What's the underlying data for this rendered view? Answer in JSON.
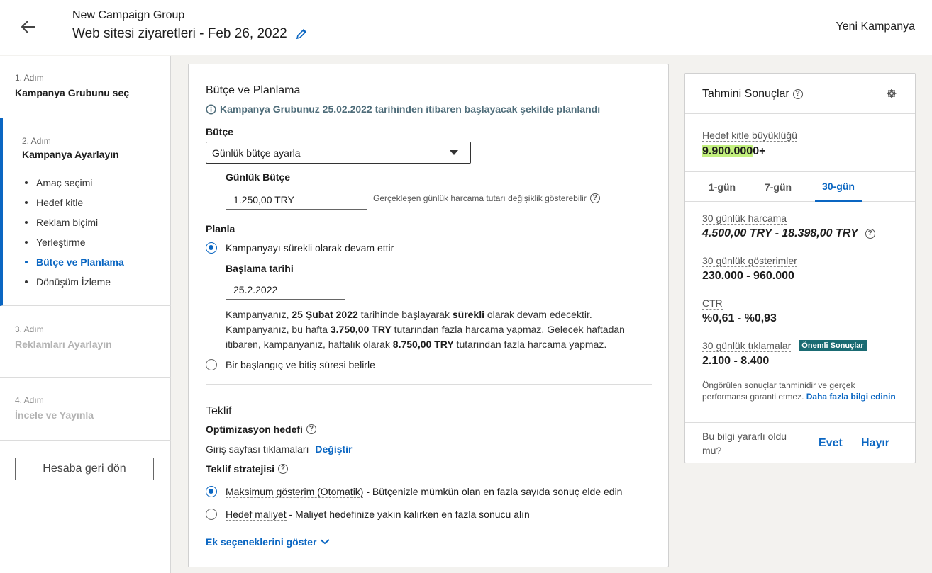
{
  "header": {
    "group_name": "New Campaign Group",
    "campaign_title": "Web sitesi ziyaretleri - Feb 26, 2022",
    "new_campaign": "Yeni Kampanya"
  },
  "sidebar": {
    "steps": [
      {
        "num": "1. Adım",
        "title": "Kampanya Grubunu seç"
      },
      {
        "num": "2. Adım",
        "title": "Kampanya Ayarlayın"
      },
      {
        "num": "3. Adım",
        "title": "Reklamları Ayarlayın"
      },
      {
        "num": "4. Adım",
        "title": "İncele ve Yayınla"
      }
    ],
    "substeps": [
      "Amaç seçimi",
      "Hedef kitle",
      "Reklam biçimi",
      "Yerleştirme",
      "Bütçe ve Planlama",
      "Dönüşüm İzleme"
    ],
    "back_button": "Hesaba geri dön"
  },
  "budget": {
    "section_title": "Bütçe ve Planlama",
    "info": "Kampanya Grubunuz 25.02.2022 tarihinden itibaren başlayacak şekilde planlandı",
    "budget_label": "Bütçe",
    "budget_select": "Günlük bütçe ayarla",
    "daily_label": "Günlük Bütçe",
    "daily_value": "1.250,00 TRY",
    "daily_hint": "Gerçekleşen günlük harcama tutarı değişiklik gösterebilir",
    "plan_label": "Planla",
    "radio_continuous": "Kampanyayı sürekli olarak devam ettir",
    "start_label": "Başlama tarihi",
    "start_value": "25.2.2022",
    "desc": {
      "p1": "Kampanyanız, ",
      "b1": "25 Şubat 2022",
      "p2": " tarihinde başlayarak ",
      "b2": "sürekli",
      "p3": " olarak devam edecektir.",
      "p4": "Kampanyanız, bu hafta ",
      "b3": "3.750,00 TRY",
      "p5": " tutarından fazla harcama yapmaz. Gelecek haftadan",
      "p6": "itibaren, kampanyanız, haftalık olarak ",
      "b4": "8.750,00 TRY",
      "p7": " tutarından fazla harcama yapmaz."
    },
    "radio_range": "Bir başlangıç ve bitiş süresi belirle"
  },
  "bid": {
    "section_title": "Teklif",
    "opt_label": "Optimizasyon hedefi",
    "opt_value": "Giriş sayfası tıklamaları",
    "change": "Değiştir",
    "strategy_label": "Teklif stratejisi",
    "max_name": "Maksimum gösterim (Otomatik)",
    "max_desc": " - Bütçenizle mümkün olan en fazla sayıda sonuç elde edin",
    "target_name": "Hedef maliyet",
    "target_desc": " - Maliyet hedefinize yakın kalırken en fazla sonucu alın",
    "more": "Ek seçeneklerini göster"
  },
  "estimates": {
    "title": "Tahmini Sonuçlar",
    "audience_label": "Hedef kitle büyüklüğü",
    "audience_value_hl": "9.900.000",
    "audience_value_rest": "0+",
    "tabs": [
      "1-gün",
      "7-gün",
      "30-gün"
    ],
    "metrics": [
      {
        "label": "30 günlük harcama",
        "value": "4.500,00 TRY - 18.398,00 TRY"
      },
      {
        "label": "30 günlük gösterimler",
        "value": "230.000 - 960.000"
      },
      {
        "label": "CTR",
        "value": "%0,61 - %0,93"
      },
      {
        "label": "30 günlük tıklamalar",
        "value": "2.100 - 8.400",
        "badge": "Önemli Sonuçlar"
      }
    ],
    "disclaimer": "Öngörülen sonuçlar tahminidir ve gerçek performansı garanti etmez. ",
    "learn_more": "Daha fazla bilgi edinin",
    "feedback_q": "Bu bilgi yararlı oldu mu?",
    "yes": "Evet",
    "no": "Hayır"
  },
  "colors": {
    "accent": "#0a66c2",
    "highlight": "#c2f07d",
    "badge": "#1a6b73"
  }
}
